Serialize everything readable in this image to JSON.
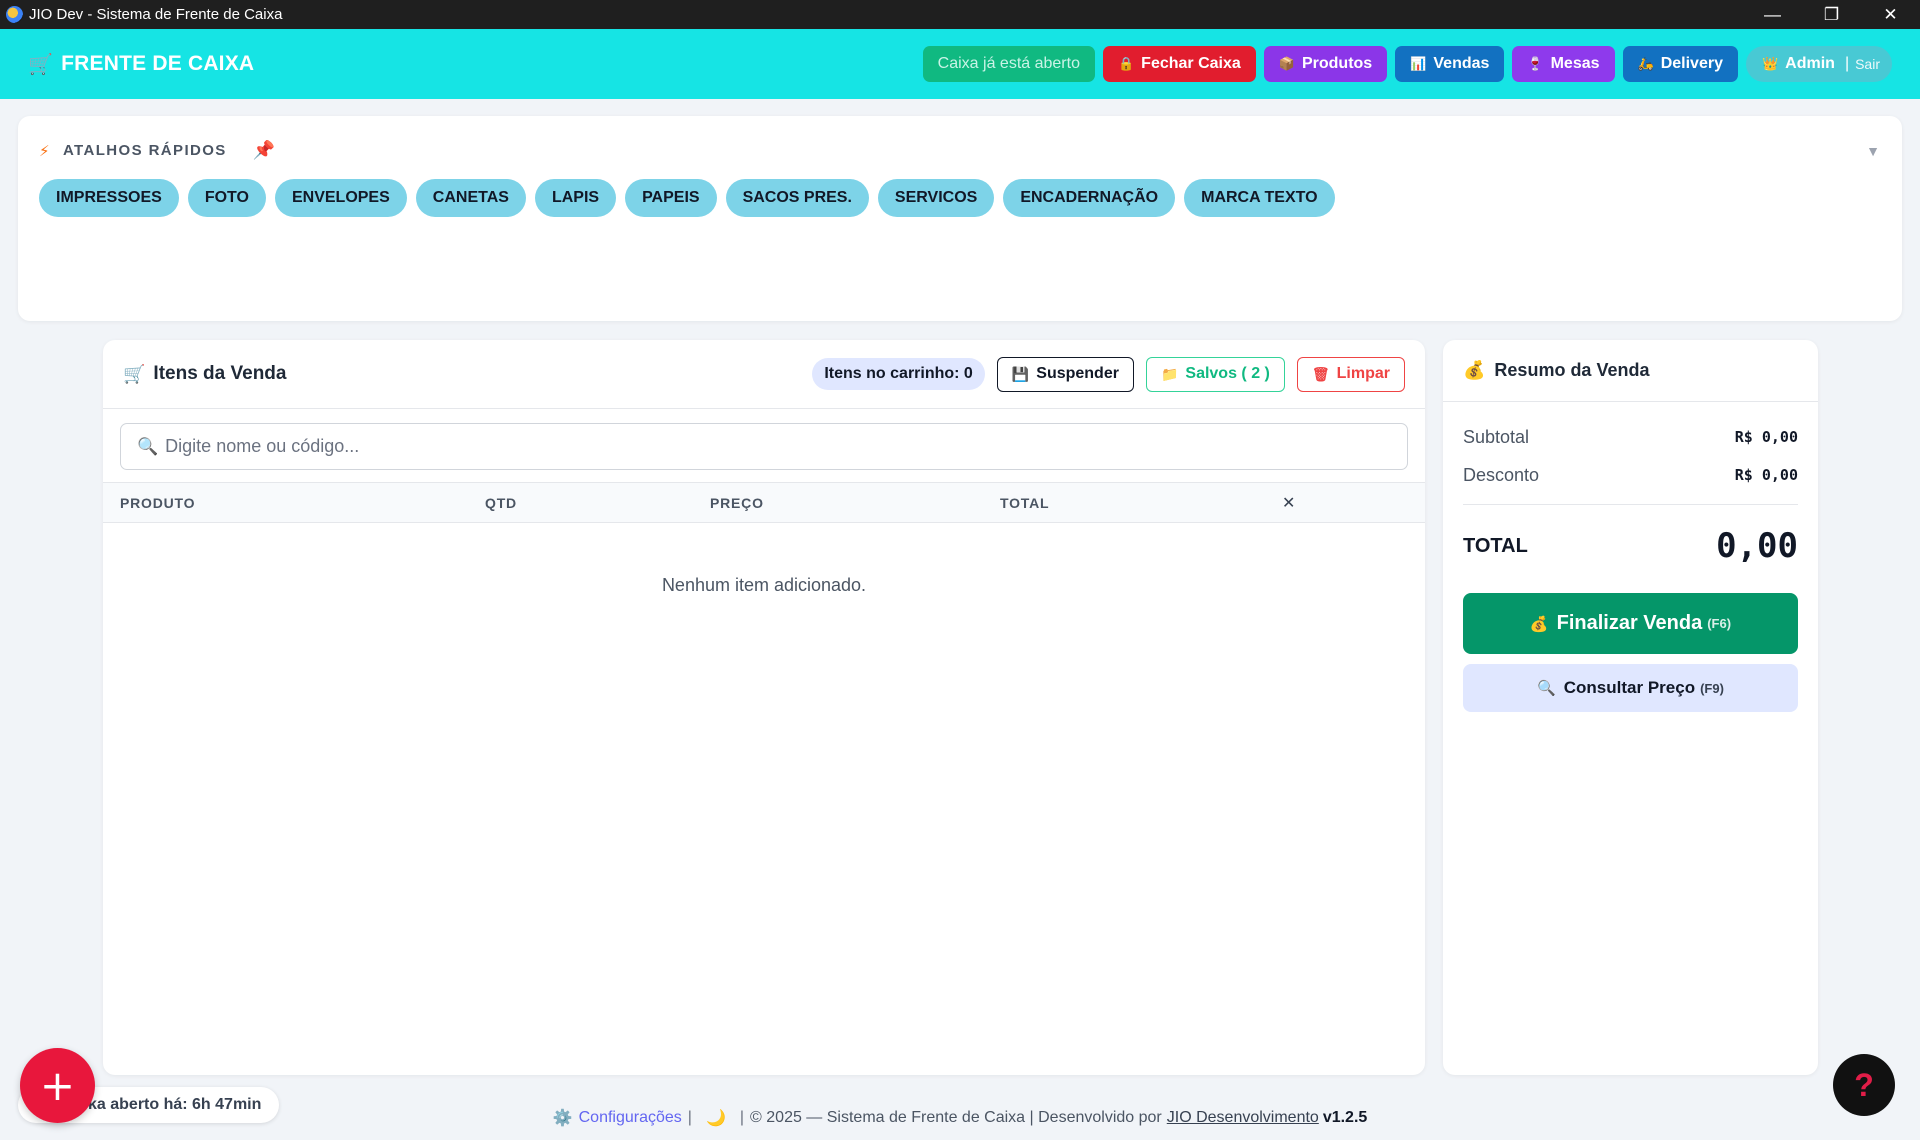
{
  "window": {
    "title": "JIO Dev - Sistema de Frente de Caixa",
    "minimize": "—",
    "restore": "❐",
    "close": "✕"
  },
  "header": {
    "brand": "FRENTE DE CAIXA",
    "cart_icon": "🛒",
    "nav": {
      "cash_open": "Caixa já está aberto",
      "close_cash": "Fechar Caixa",
      "close_cash_icon": "🔒",
      "products": "Produtos",
      "products_icon": "📦",
      "sales": "Vendas",
      "sales_icon": "📊",
      "tables": "Mesas",
      "tables_icon": "🍷",
      "delivery": "Delivery",
      "delivery_icon": "🛵",
      "admin": "Admin",
      "admin_icon": "👑",
      "admin_sep": "|",
      "logout": "Sair"
    }
  },
  "shortcuts": {
    "title": "ATALHOS RÁPIDOS",
    "bolt_icon": "⚡",
    "pin_icon": "📌",
    "toggle": "▼",
    "items": [
      "IMPRESSOES",
      "FOTO",
      "ENVELOPES",
      "CANETAS",
      "LAPIS",
      "PAPEIS",
      "SACOS PRES.",
      "SERVICOS",
      "ENCADERNAÇÃO",
      "MARCA TEXTO"
    ]
  },
  "items_panel": {
    "title": "Itens da Venda",
    "cart_icon": "🛒",
    "cart_count": "Itens no carrinho: 0",
    "suspend": "Suspender",
    "suspend_icon": "💾",
    "saved": "Salvos ( 2 )",
    "saved_icon": "📁",
    "clear": "Limpar",
    "clear_icon": "🗑",
    "search_icon": "🔍",
    "search_placeholder": "Digite nome ou código...",
    "columns": {
      "product": "PRODUTO",
      "qty": "QTD",
      "price": "PREÇO",
      "total": "TOTAL",
      "remove": "✕"
    },
    "empty": "Nenhum item adicionado."
  },
  "summary": {
    "title": "Resumo da Venda",
    "bag_icon": "💰",
    "subtotal_label": "Subtotal",
    "subtotal_value": "R$ 0,00",
    "discount_label": "Desconto",
    "discount_value": "R$ 0,00",
    "total_label": "TOTAL",
    "total_value": "0,00",
    "finalize": "Finalizar Venda",
    "finalize_icon": "💰",
    "finalize_key": "(F6)",
    "consult": "Consultar Preço",
    "consult_icon": "🔍",
    "consult_key": "(F9)"
  },
  "footer": {
    "gear_icon": "⚙️",
    "settings": "Configurações",
    "sep": "|",
    "moon_icon": "🌙",
    "copyright": "© 2025 — Sistema de Frente de Caixa | Desenvolvido por",
    "developer": "JIO Desenvolvimento",
    "version": "v1.2.5"
  },
  "status": {
    "cash_timer": "ka aberto há: 6h 47min"
  },
  "fab": {
    "add": "+",
    "help": "?"
  }
}
